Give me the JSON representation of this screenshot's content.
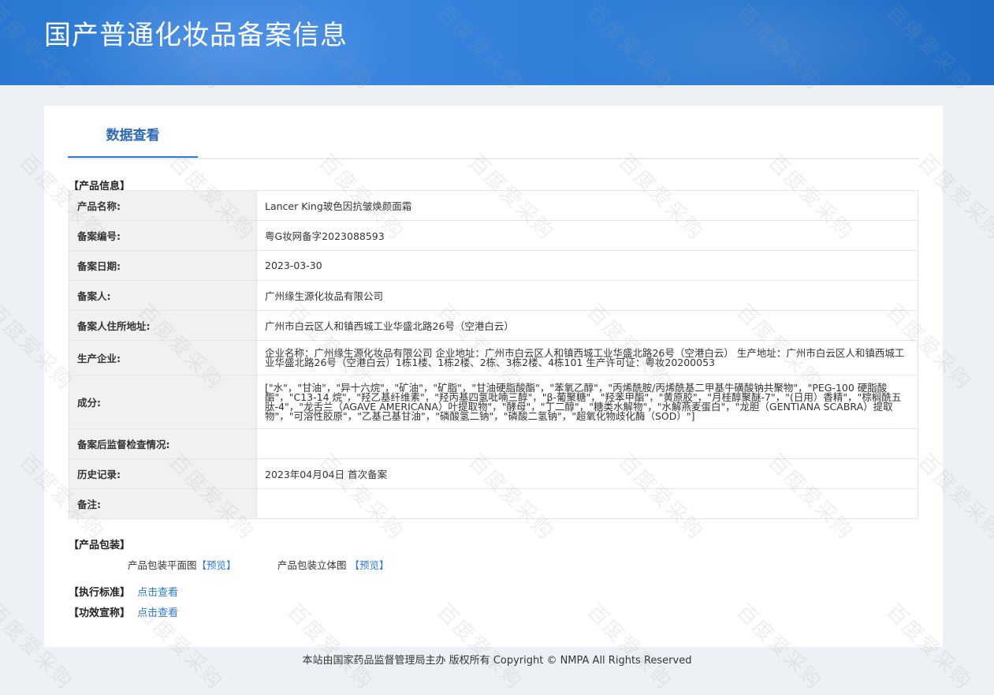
{
  "header": {
    "title": "国产普通化妆品备案信息"
  },
  "tabs": [
    {
      "label": "数据查看"
    }
  ],
  "product_info": {
    "section_title": "【产品信息】",
    "rows": [
      {
        "key": "产品名称:",
        "value": "Lancer King玻色因抗皱焕颜面霜"
      },
      {
        "key": "备案编号:",
        "value": "粤G妆网备字2023088593"
      },
      {
        "key": "备案日期:",
        "value": "2023-03-30"
      },
      {
        "key": "备案人:",
        "value": "广州缘生源化妆品有限公司"
      },
      {
        "key": "备案人住所地址:",
        "value": "广州市白云区人和镇西城工业华盛北路26号（空港白云）"
      },
      {
        "key": "生产企业:",
        "value": "企业名称：广州缘生源化妆品有限公司 企业地址：广州市白云区人和镇西城工业华盛北路26号（空港白云） 生产地址：广州市白云区人和镇西城工业华盛北路26号（空港白云）1栋1楼、1栋2楼、2栋、3栋2楼、4栋101 生产许可证：粤妆20200053"
      },
      {
        "key": "成分:",
        "value": "[\"水\"，\"甘油\"，\"异十六烷\"，\"矿油\"，\"矿脂\"，\"甘油硬脂酸酯\"，\"苯氧乙醇\"，\"丙烯酰胺/丙烯酰基二甲基牛磺酸钠共聚物\"，\"PEG-100 硬脂酸酯\"，\"C13-14 烷\"，\"羟乙基纤维素\"，\"羟丙基四氢吡喃三醇\"，\"β-葡聚糖\"，\"羟苯甲酯\"，\"黄原胶\"，\"月桂醇聚醚-7\"，\"(日用）香精\"，\"棕榈酰五肽-4\"，\"龙舌兰（AGAVE AMERICANA）叶提取物\"，\"酵母\"，\"丁二醇\"，\"糖类水解物\"，\"水解燕麦蛋白\"，\"龙胆（GENTIANA SCABRA）提取物\"，\"可溶性胶原\"，\"乙基己基甘油\"，\"磷酸氢二钠\"，\"磷酸二氢钠\"，\"超氧化物歧化酶（SOD）\"]"
      },
      {
        "key": "备案后监督检查情况:",
        "value": ""
      },
      {
        "key": "历史记录:",
        "value": "2023年04月04日 首次备案"
      },
      {
        "key": "备注:",
        "value": ""
      }
    ]
  },
  "packaging": {
    "section_title": "【产品包装】",
    "flat_label": "产品包装平面图",
    "flat_preview": "【预览】",
    "solid_label": "产品包装立体图",
    "solid_preview": "【预览】"
  },
  "standard": {
    "label": "【执行标准】",
    "link": "点击查看"
  },
  "efficacy": {
    "label": "【功效宣称】",
    "link": "点击查看"
  },
  "footer": {
    "text": "本站由国家药品监督管理局主办 版权所有 Copyright © NMPA All Rights Reserved"
  },
  "watermark": {
    "text": "百度爱采购"
  }
}
